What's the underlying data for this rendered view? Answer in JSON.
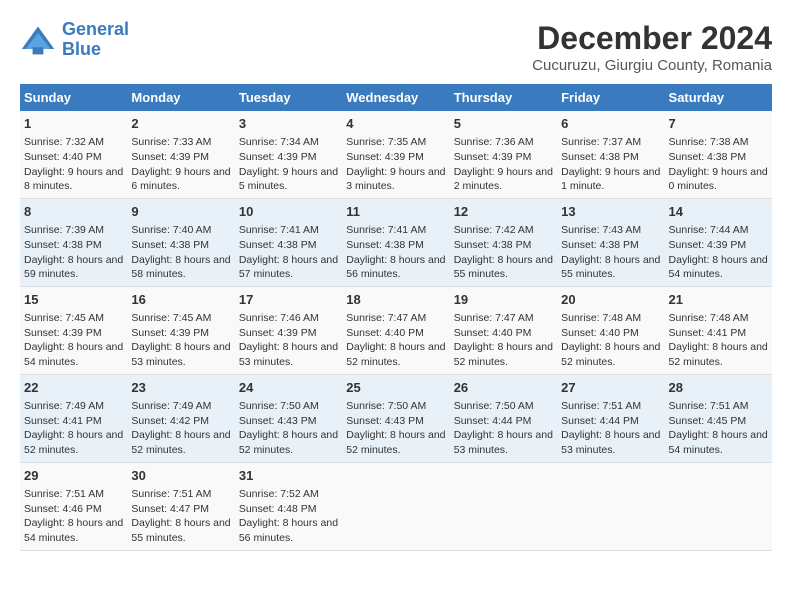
{
  "header": {
    "logo_line1": "General",
    "logo_line2": "Blue",
    "title": "December 2024",
    "subtitle": "Cucuruzu, Giurgiu County, Romania"
  },
  "days_of_week": [
    "Sunday",
    "Monday",
    "Tuesday",
    "Wednesday",
    "Thursday",
    "Friday",
    "Saturday"
  ],
  "weeks": [
    [
      {
        "day": "1",
        "sunrise": "7:32 AM",
        "sunset": "4:40 PM",
        "daylight": "9 hours and 8 minutes."
      },
      {
        "day": "2",
        "sunrise": "7:33 AM",
        "sunset": "4:39 PM",
        "daylight": "9 hours and 6 minutes."
      },
      {
        "day": "3",
        "sunrise": "7:34 AM",
        "sunset": "4:39 PM",
        "daylight": "9 hours and 5 minutes."
      },
      {
        "day": "4",
        "sunrise": "7:35 AM",
        "sunset": "4:39 PM",
        "daylight": "9 hours and 3 minutes."
      },
      {
        "day": "5",
        "sunrise": "7:36 AM",
        "sunset": "4:39 PM",
        "daylight": "9 hours and 2 minutes."
      },
      {
        "day": "6",
        "sunrise": "7:37 AM",
        "sunset": "4:38 PM",
        "daylight": "9 hours and 1 minute."
      },
      {
        "day": "7",
        "sunrise": "7:38 AM",
        "sunset": "4:38 PM",
        "daylight": "9 hours and 0 minutes."
      }
    ],
    [
      {
        "day": "8",
        "sunrise": "7:39 AM",
        "sunset": "4:38 PM",
        "daylight": "8 hours and 59 minutes."
      },
      {
        "day": "9",
        "sunrise": "7:40 AM",
        "sunset": "4:38 PM",
        "daylight": "8 hours and 58 minutes."
      },
      {
        "day": "10",
        "sunrise": "7:41 AM",
        "sunset": "4:38 PM",
        "daylight": "8 hours and 57 minutes."
      },
      {
        "day": "11",
        "sunrise": "7:41 AM",
        "sunset": "4:38 PM",
        "daylight": "8 hours and 56 minutes."
      },
      {
        "day": "12",
        "sunrise": "7:42 AM",
        "sunset": "4:38 PM",
        "daylight": "8 hours and 55 minutes."
      },
      {
        "day": "13",
        "sunrise": "7:43 AM",
        "sunset": "4:38 PM",
        "daylight": "8 hours and 55 minutes."
      },
      {
        "day": "14",
        "sunrise": "7:44 AM",
        "sunset": "4:39 PM",
        "daylight": "8 hours and 54 minutes."
      }
    ],
    [
      {
        "day": "15",
        "sunrise": "7:45 AM",
        "sunset": "4:39 PM",
        "daylight": "8 hours and 54 minutes."
      },
      {
        "day": "16",
        "sunrise": "7:45 AM",
        "sunset": "4:39 PM",
        "daylight": "8 hours and 53 minutes."
      },
      {
        "day": "17",
        "sunrise": "7:46 AM",
        "sunset": "4:39 PM",
        "daylight": "8 hours and 53 minutes."
      },
      {
        "day": "18",
        "sunrise": "7:47 AM",
        "sunset": "4:40 PM",
        "daylight": "8 hours and 52 minutes."
      },
      {
        "day": "19",
        "sunrise": "7:47 AM",
        "sunset": "4:40 PM",
        "daylight": "8 hours and 52 minutes."
      },
      {
        "day": "20",
        "sunrise": "7:48 AM",
        "sunset": "4:40 PM",
        "daylight": "8 hours and 52 minutes."
      },
      {
        "day": "21",
        "sunrise": "7:48 AM",
        "sunset": "4:41 PM",
        "daylight": "8 hours and 52 minutes."
      }
    ],
    [
      {
        "day": "22",
        "sunrise": "7:49 AM",
        "sunset": "4:41 PM",
        "daylight": "8 hours and 52 minutes."
      },
      {
        "day": "23",
        "sunrise": "7:49 AM",
        "sunset": "4:42 PM",
        "daylight": "8 hours and 52 minutes."
      },
      {
        "day": "24",
        "sunrise": "7:50 AM",
        "sunset": "4:43 PM",
        "daylight": "8 hours and 52 minutes."
      },
      {
        "day": "25",
        "sunrise": "7:50 AM",
        "sunset": "4:43 PM",
        "daylight": "8 hours and 52 minutes."
      },
      {
        "day": "26",
        "sunrise": "7:50 AM",
        "sunset": "4:44 PM",
        "daylight": "8 hours and 53 minutes."
      },
      {
        "day": "27",
        "sunrise": "7:51 AM",
        "sunset": "4:44 PM",
        "daylight": "8 hours and 53 minutes."
      },
      {
        "day": "28",
        "sunrise": "7:51 AM",
        "sunset": "4:45 PM",
        "daylight": "8 hours and 54 minutes."
      }
    ],
    [
      {
        "day": "29",
        "sunrise": "7:51 AM",
        "sunset": "4:46 PM",
        "daylight": "8 hours and 54 minutes."
      },
      {
        "day": "30",
        "sunrise": "7:51 AM",
        "sunset": "4:47 PM",
        "daylight": "8 hours and 55 minutes."
      },
      {
        "day": "31",
        "sunrise": "7:52 AM",
        "sunset": "4:48 PM",
        "daylight": "8 hours and 56 minutes."
      },
      {
        "day": "",
        "sunrise": "",
        "sunset": "",
        "daylight": ""
      },
      {
        "day": "",
        "sunrise": "",
        "sunset": "",
        "daylight": ""
      },
      {
        "day": "",
        "sunrise": "",
        "sunset": "",
        "daylight": ""
      },
      {
        "day": "",
        "sunrise": "",
        "sunset": "",
        "daylight": ""
      }
    ]
  ]
}
